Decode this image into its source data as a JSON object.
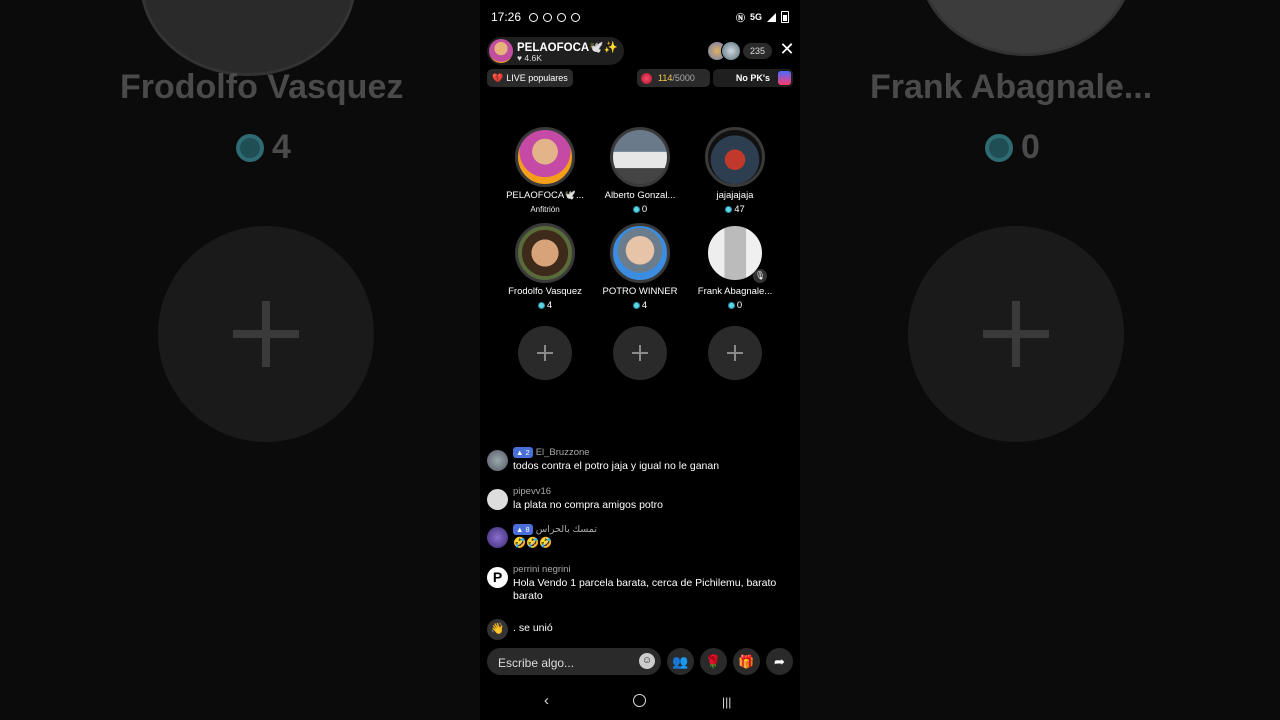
{
  "background": {
    "left_name": "Frodolfo Vasquez",
    "left_score": "4",
    "right_name": "Frank Abagnale...",
    "right_score": "0"
  },
  "status_bar": {
    "time": "17:26",
    "network": "5G"
  },
  "host": {
    "name": "PELAOFOCA🕊️✨",
    "likes": "♥ 4.6K"
  },
  "viewers": {
    "count": "235"
  },
  "live_popular": {
    "label": "LIVE populares"
  },
  "gift_goal": {
    "current": "114",
    "total": "/5000"
  },
  "pk": {
    "label": "No PK's"
  },
  "guests": [
    {
      "name": "PELAOFOCA🕊️...",
      "role": "Anfitrión"
    },
    {
      "name": "Alberto Gonzal...",
      "score": "0"
    },
    {
      "name": "jajajajaja",
      "score": "47"
    },
    {
      "name": "Frodolfo Vasquez",
      "score": "4"
    },
    {
      "name": "POTRO WINNER",
      "score": "4"
    },
    {
      "name": "Frank Abagnale...",
      "score": "0"
    }
  ],
  "chat": [
    {
      "user": "El_Bruzzone",
      "level": "2",
      "text": "todos contra el potro jaja y igual no le ganan"
    },
    {
      "user": "pipevv16",
      "text": "la plata no compra amigos potro"
    },
    {
      "user": "تمسك بالحراس",
      "level": "8",
      "text": "🤣🤣🤣"
    },
    {
      "user": "perrini negrini",
      "text": "Hola Vendo 1 parcela barata, cerca de Pichilemu, barato barato"
    },
    {
      "user": "",
      "text": ". se unió"
    }
  ],
  "composer": {
    "placeholder": "Escribe algo..."
  },
  "colors": {
    "accent_gold": "#f5c84a",
    "score_dot": "#5fd4e8",
    "level_badge": "#4a6fd8"
  }
}
